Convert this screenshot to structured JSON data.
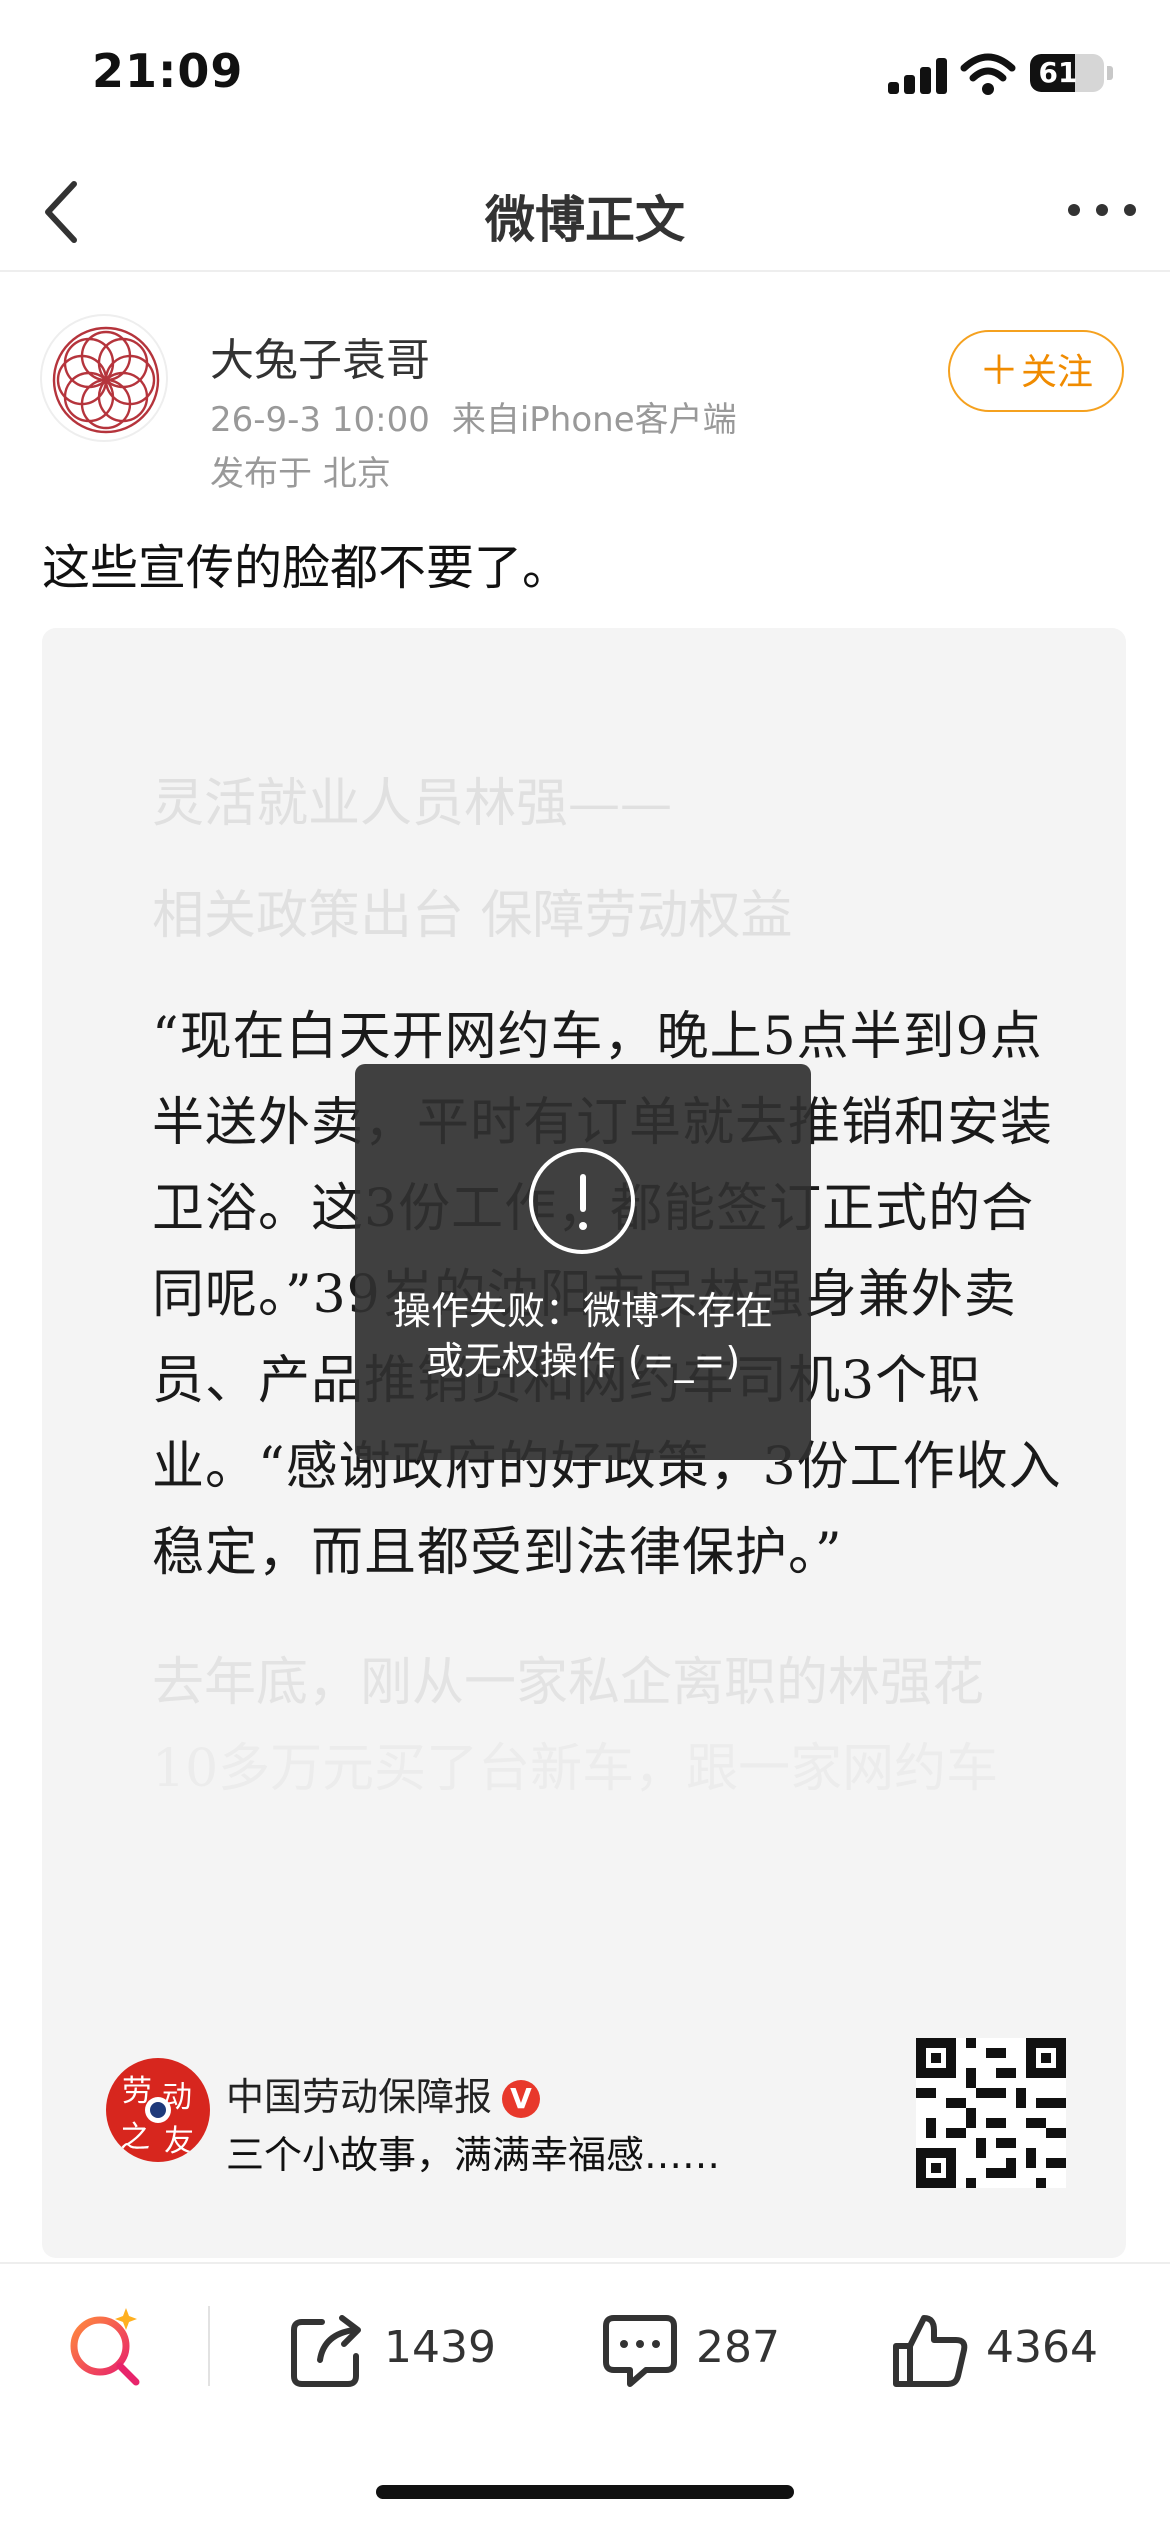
{
  "status_bar": {
    "time": "21:09",
    "battery": "61",
    "battery_level": 0.61
  },
  "nav": {
    "title": "微博正文",
    "back_icon": "chevron-left-icon",
    "more_icon": "more-horizontal-icon"
  },
  "author": {
    "name": "大兔子袁哥",
    "time": "26-9-3 10:00",
    "source": "来自iPhone客户端",
    "location": "发布于 北京",
    "follow_label": "关注",
    "avatar_color": "#b5343c"
  },
  "post": {
    "text": "这些宣传的脸都不要了。"
  },
  "article": {
    "faded_title": "灵活就业人员林强——",
    "faded_subtitle": "相关政策出台 保障劳动权益",
    "quote": "“现在白天开网约车，晚上5点半到9点半送外卖，平时有订单就去推销和安装卫浴。这3份工作，都能签订正式的合同呢。”39岁的沈阳市民林强身兼外卖员、产品推销员和网约车司机3个职业。“感谢政府的好政策，3份工作收入稳定，而且都受到法律保护。”",
    "faded_para_1": "去年底，刚从一家私企离职的林强花",
    "faded_para_2": "10多万元买了台新车，跟一家网约车"
  },
  "source_card": {
    "name": "中国劳动保障报",
    "verified_badge": "V",
    "subtitle": "三个小故事，满满幸福感……",
    "logo_color": "#d7261e"
  },
  "toast": {
    "message": "操作失败：微博不存在或无权操作 (=_=)",
    "icon": "exclamation-circle-icon"
  },
  "toolbar": {
    "repost_count": "1439",
    "comment_count": "287",
    "like_count": "4364"
  },
  "colors": {
    "accent_orange": "#f08b00",
    "text_gray": "#999999"
  }
}
